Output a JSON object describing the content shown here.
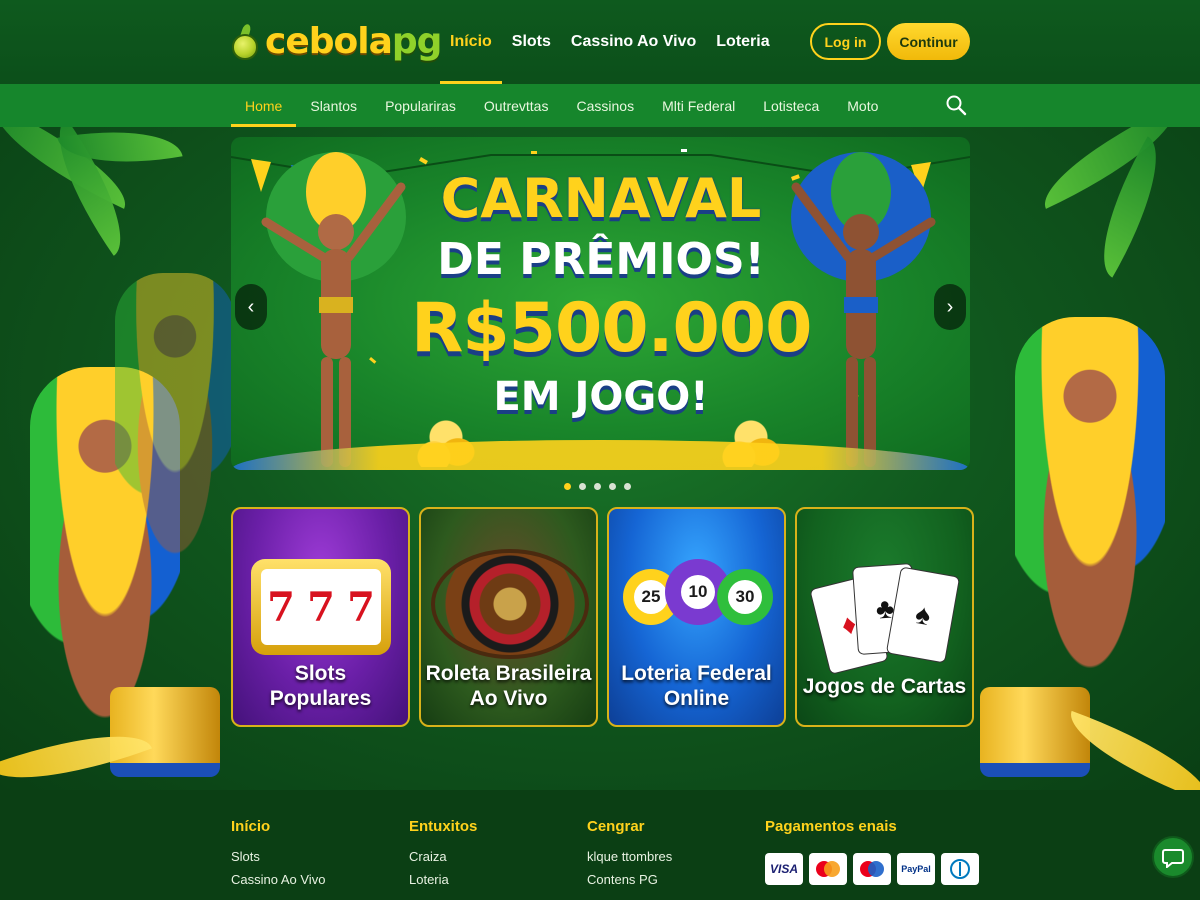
{
  "brand": {
    "logo_part1": "cebola",
    "logo_part2": "pg"
  },
  "header": {
    "nav": [
      {
        "label": "Início",
        "active": true
      },
      {
        "label": "Slots",
        "active": false
      },
      {
        "label": "Cassino Ao Vivo",
        "active": false
      },
      {
        "label": "Loteria",
        "active": false
      }
    ],
    "login_label": "Log in",
    "continue_label": "Continur"
  },
  "subnav": {
    "items": [
      {
        "label": "Home",
        "active": true
      },
      {
        "label": "Slantos",
        "active": false
      },
      {
        "label": "Populariras",
        "active": false
      },
      {
        "label": "Outrevttas",
        "active": false
      },
      {
        "label": "Cassinos",
        "active": false
      },
      {
        "label": "Mlti Federal",
        "active": false
      },
      {
        "label": "Lotisteca",
        "active": false
      },
      {
        "label": "Moto",
        "active": false
      }
    ],
    "search_icon": "search-icon"
  },
  "carousel": {
    "line1": "CARNAVAL",
    "line2": "DE PRÊMIOS!",
    "line3": "R$500.000",
    "line4": "EM JOGO!",
    "slide_count": 5,
    "active_slide": 1,
    "prev_icon": "chevron-left-icon",
    "next_icon": "chevron-right-icon"
  },
  "cards": [
    {
      "label": "Slots\nPopulares",
      "reels": [
        "7",
        "7",
        "7"
      ]
    },
    {
      "label": "Roleta Brasileira\nAo Vivo"
    },
    {
      "label": "Loteria Federal\nOnline",
      "balls": [
        "25",
        "10",
        "30"
      ]
    },
    {
      "label": "Jogos de Cartas"
    }
  ],
  "footer": {
    "col1": {
      "title": "Início",
      "links": [
        "Slots",
        "Cassino Ao Vivo"
      ]
    },
    "col2": {
      "title": "Entuxitos",
      "links": [
        "Craiza",
        "Loteria"
      ]
    },
    "col3": {
      "title": "Cengrar",
      "links": [
        "klque ttombres",
        "Contens PG"
      ]
    },
    "col4": {
      "title": "Pagamentos enais",
      "methods": [
        "VISA",
        "mastercard",
        "mastercard",
        "PayPal",
        "Diners"
      ]
    }
  },
  "chat_icon": "chat-bubble-icon",
  "colors": {
    "accent": "#ffd21c",
    "primary_green": "#16862c",
    "dark_green": "#0b4a18"
  }
}
